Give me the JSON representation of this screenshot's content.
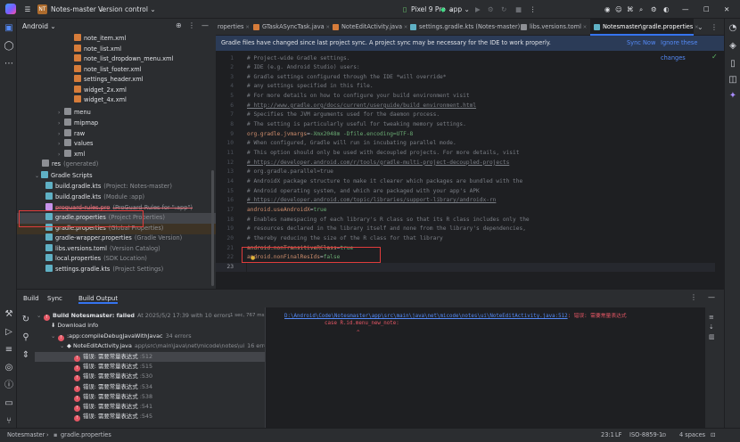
{
  "titlebar": {
    "project_badge": "NT",
    "project_name": "Notes-master",
    "vcs": "Version control",
    "device": "Pixel 9 Pro",
    "run_config": "app"
  },
  "project_panel": {
    "view_label": "Android",
    "tree": [
      {
        "label": "note_item.xml",
        "extra": ""
      },
      {
        "label": "note_list.xml",
        "extra": ""
      },
      {
        "label": "note_list_dropdown_menu.xml",
        "extra": ""
      },
      {
        "label": "note_list_footer.xml",
        "extra": ""
      },
      {
        "label": "settings_header.xml",
        "extra": ""
      },
      {
        "label": "widget_2x.xml",
        "extra": ""
      },
      {
        "label": "widget_4x.xml",
        "extra": ""
      },
      {
        "label": "menu",
        "extra": ""
      },
      {
        "label": "mipmap",
        "extra": ""
      },
      {
        "label": "raw",
        "extra": ""
      },
      {
        "label": "values",
        "extra": ""
      },
      {
        "label": "xml",
        "extra": ""
      },
      {
        "label": "res",
        "extra": "(generated)"
      },
      {
        "label": "Gradle Scripts",
        "extra": ""
      },
      {
        "label": "build.gradle.kts",
        "extra": "(Project: Notes-master)"
      },
      {
        "label": "build.gradle.kts",
        "extra": "(Module :app)"
      },
      {
        "label": "proguard-rules.pro",
        "extra": "(ProGuard Rules for \":app\")"
      },
      {
        "label": "gradle.properties",
        "extra": "(Project Properties)"
      },
      {
        "label": "gradle.properties",
        "extra": "(Global Properties)"
      },
      {
        "label": "gradle-wrapper.properties",
        "extra": "(Gradle Version)"
      },
      {
        "label": "libs.versions.toml",
        "extra": "(Version Catalog)"
      },
      {
        "label": "local.properties",
        "extra": "(SDK Location)"
      },
      {
        "label": "settings.gradle.kts",
        "extra": "(Project Settings)"
      }
    ]
  },
  "editor": {
    "tabs": [
      {
        "label": "roperties"
      },
      {
        "label": "GTaskASyncTask.java"
      },
      {
        "label": "NoteEditActivity.java"
      },
      {
        "label": "settings.gradle.kts (Notes-master)"
      },
      {
        "label": "libs.versions.toml"
      },
      {
        "label": "Notesmaster\\gradle.properties"
      }
    ],
    "banner_text": "Gradle files have changed since last project sync. A project sync may be necessary for the IDE to work properly.",
    "banner_sync": "Sync Now",
    "banner_ignore": "Ignore these changes",
    "lines": [
      {
        "n": "1",
        "t": "# Project-wide Gradle settings.",
        "c": "cm"
      },
      {
        "n": "2",
        "t": "# IDE (e.g. Android Studio) users:",
        "c": "cm"
      },
      {
        "n": "3",
        "t": "# Gradle settings configured through the IDE *will override*",
        "c": "cm"
      },
      {
        "n": "4",
        "t": "# any settings specified in this file.",
        "c": "cm"
      },
      {
        "n": "5",
        "t": "# For more details on how to configure your build environment visit",
        "c": "cm"
      },
      {
        "n": "6",
        "t": "# http://www.gradle.org/docs/current/userguide/build_environment.html",
        "c": "cmu"
      },
      {
        "n": "7",
        "t": "# Specifies the JVM arguments used for the daemon process.",
        "c": "cm"
      },
      {
        "n": "8",
        "t": "# The setting is particularly useful for tweaking memory settings.",
        "c": "cm"
      },
      {
        "n": "9",
        "t": "org.gradle.jvmargs=-Xmx2048m -Dfile.encoding=UTF-8",
        "c": "kv"
      },
      {
        "n": "10",
        "t": "# When configured, Gradle will run in incubating parallel mode.",
        "c": "cm"
      },
      {
        "n": "11",
        "t": "# This option should only be used with decoupled projects. For more details, visit",
        "c": "cm"
      },
      {
        "n": "12",
        "t": "# https://developer.android.com/r/tools/gradle-multi-project-decoupled-projects",
        "c": "cmu"
      },
      {
        "n": "13",
        "t": "# org.gradle.parallel=true",
        "c": "cm"
      },
      {
        "n": "14",
        "t": "# AndroidX package structure to make it clearer which packages are bundled with the",
        "c": "cm"
      },
      {
        "n": "15",
        "t": "# Android operating system, and which are packaged with your app's APK",
        "c": "cm"
      },
      {
        "n": "16",
        "t": "# https://developer.android.com/topic/libraries/support-library/androidx-rn",
        "c": "cmu"
      },
      {
        "n": "17",
        "t": "android.useAndroidX=true",
        "c": "kv"
      },
      {
        "n": "18",
        "t": "# Enables namespacing of each library's R class so that its R class includes only the",
        "c": "cm"
      },
      {
        "n": "19",
        "t": "# resources declared in the library itself and none from the library's dependencies,",
        "c": "cm"
      },
      {
        "n": "20",
        "t": "# thereby reducing the size of the R class for that library",
        "c": "cm"
      },
      {
        "n": "21",
        "t": "android.nonTransitiveRClass=true",
        "c": "kv"
      },
      {
        "n": "22",
        "t": "android.nonFinalResIds=false",
        "c": "kv"
      },
      {
        "n": "23",
        "t": "",
        "c": "cm"
      }
    ]
  },
  "build_panel": {
    "tabs": [
      "Build",
      "Sync",
      "Build Output"
    ],
    "root": "Build Notesmaster: failed",
    "root_time": "At 2025/5/2 17:39 with 10 errors",
    "root_duration": "1 sec, 767 ms",
    "download": "Download info",
    "task": ":app:compileDebugJavaWithJavac",
    "task_errors": "34 errors",
    "file": "NoteEditActivity.java",
    "file_path": "app\\src\\main\\java\\net\\micode\\notes\\ui",
    "file_errors": "16 errors",
    "error_label": "错误: 需要常量表达式",
    "error_lines": [
      ":512",
      ":515",
      ":530",
      ":534",
      ":538",
      ":541",
      ":545"
    ],
    "output_path": "D:\\Android\\Code\\Notesmaster\\app\\src\\main\\java\\net\\micode\\notes\\ui\\NoteEditActivity.java:512",
    "output_msg": ": 错误: 需要常量表达式",
    "output_code": "case R.id.menu_new_note:",
    "output_caret": "^"
  },
  "statusbar": {
    "crumb_project": "Notesmaster",
    "crumb_file": "gradle.properties",
    "position": "23:1",
    "line_sep": "LF",
    "encoding": "ISO-8859-1",
    "indent": "4 spaces"
  },
  "colors": {
    "accent": "#3574f0",
    "error": "#e55765",
    "annotation": "#e03c3c"
  }
}
